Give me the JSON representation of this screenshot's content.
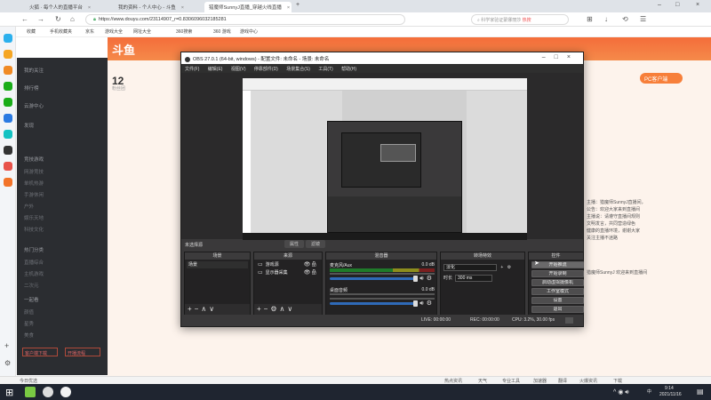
{
  "browser": {
    "tabs": [
      {
        "label": "火狐 · 每个人的直播平台"
      },
      {
        "label": "我的资料 - 个人中心 - 斗鱼"
      },
      {
        "label": "猎魔师SunnyJ直播_穿越火线直播",
        "active": true
      }
    ],
    "url": "https://www.douyu.com/23114907_r=0.8306096032185281",
    "search_placeholder": "科学家验证蒙娜丽莎",
    "search_extra": "热搜",
    "bookmarks": [
      "收藏",
      "手机收藏夹",
      "京东",
      "游戏大全",
      "网址大全",
      "360搜索",
      "360 游戏",
      "游戏中心"
    ]
  },
  "douyu_sidebar": {
    "items": [
      "我的关注",
      "排行榜",
      "云游中心",
      "发现",
      "竞技游戏",
      "网游竞技",
      "单机热游",
      "手游休闲",
      "户外",
      "娱乐天地",
      "科技文化",
      "正能量",
      "热门分类",
      "直播综合",
      "主机游戏",
      "二次元",
      "一起看",
      "颜值",
      "星秀",
      "美食",
      "旅游"
    ],
    "bottom_buttons": [
      "客户端下载",
      "开播流程"
    ]
  },
  "page": {
    "logo": "斗鱼",
    "fan_count": "12",
    "fan_label": "粉丝团",
    "pc_button": "PC客户端",
    "right_text": [
      "主播：猎魔师SunnyJ直播间，",
      "公告：欢迎大家来到直播间",
      "主播说：请遵守直播间规则",
      "文明发言，共同营造绿色",
      "健康的直播环境，谢谢大家",
      "关注主播不迷路",
      "猎魔师SunnyJ 欢迎来到直播间"
    ]
  },
  "obs": {
    "title": "OBS 27.0.1 (64-bit, windows) - 配置文件: 未命名 - 场景: 未命名",
    "menu": [
      "文件(F)",
      "编辑(E)",
      "视图(V)",
      "停靠部件(D)",
      "场景集合(S)",
      "工具(T)",
      "帮助(H)"
    ],
    "current_scene_label": "未选择源",
    "toolbar_tabs": [
      "属性",
      "滤镜"
    ],
    "docks": {
      "scenes": {
        "title": "场景",
        "items": [
          "场景"
        ]
      },
      "sources": {
        "title": "来源",
        "items": [
          "游戏源",
          "显示器采集"
        ]
      },
      "mixer": {
        "title": "混音器",
        "tracks": [
          {
            "name": "麦克风/Aux",
            "db": "0.0 dB"
          },
          {
            "name": "桌面音频",
            "db": "0.0 dB"
          }
        ]
      },
      "transitions": {
        "title": "转场特效",
        "type": "淡化",
        "duration_label": "时长",
        "duration": "300 ms"
      },
      "controls": {
        "title": "控件",
        "buttons": [
          "开始推流",
          "开始录制",
          "启动虚拟摄像机",
          "工作室模式",
          "设置",
          "退出"
        ]
      }
    },
    "status": {
      "live": "LIVE: 00:00:00",
      "rec": "REC: 00:00:00",
      "cpu": "CPU: 3.2%, 30.00 fps"
    }
  },
  "taskbar": {
    "search_hint": "今日优选",
    "items": [
      "热点资讯",
      "天气",
      "专业工具",
      "加速器",
      "翻译",
      "火爆资讯",
      "下载"
    ],
    "time": "9:14",
    "date": "2021/11/16",
    "lang": "中"
  }
}
